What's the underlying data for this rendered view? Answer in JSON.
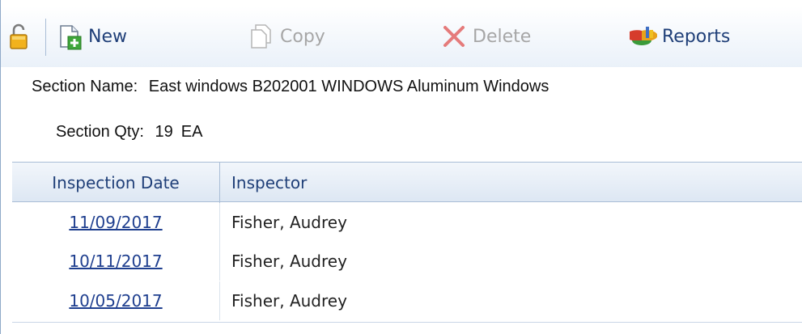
{
  "toolbar": {
    "new_label": "New",
    "copy_label": "Copy",
    "delete_label": "Delete",
    "reports_label": "Reports"
  },
  "section": {
    "name_label": "Section Name:",
    "name_value": "East windows B202001 WINDOWS Aluminum Windows",
    "qty_label": "Section Qty:",
    "qty_value": "19",
    "qty_unit": "EA"
  },
  "grid": {
    "columns": [
      "Inspection Date",
      "Inspector"
    ],
    "rows": [
      {
        "date": "11/09/2017",
        "inspector": "Fisher, Audrey"
      },
      {
        "date": "10/11/2017",
        "inspector": "Fisher, Audrey"
      },
      {
        "date": "10/05/2017",
        "inspector": "Fisher, Audrey"
      }
    ]
  },
  "colors": {
    "accent": "#1f3f78",
    "disabled": "#a6a6a6",
    "link": "#1f3f8f"
  }
}
